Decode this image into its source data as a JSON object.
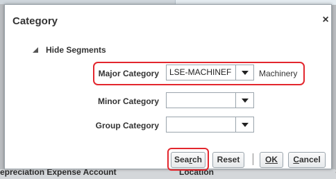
{
  "dialog": {
    "title": "Category",
    "close_glyph": "×"
  },
  "segments": {
    "toggle_label": "Hide Segments"
  },
  "fields": {
    "major": {
      "label": "Major Category",
      "value": "LSE-MACHINEF",
      "description": "Machinery"
    },
    "minor": {
      "label": "Minor Category",
      "value": ""
    },
    "group": {
      "label": "Group Category",
      "value": ""
    }
  },
  "buttons": {
    "search_pre": "Sea",
    "search_accel": "r",
    "search_post": "ch",
    "reset": "Reset",
    "separator": "|",
    "ok_pre": "O",
    "ok_accel": "K",
    "cancel_accel": "C",
    "cancel_post": "ancel"
  },
  "background": {
    "left_text": "epreciation Expense Account",
    "right_text": "Location"
  },
  "colors": {
    "highlight": "#e3262d"
  }
}
